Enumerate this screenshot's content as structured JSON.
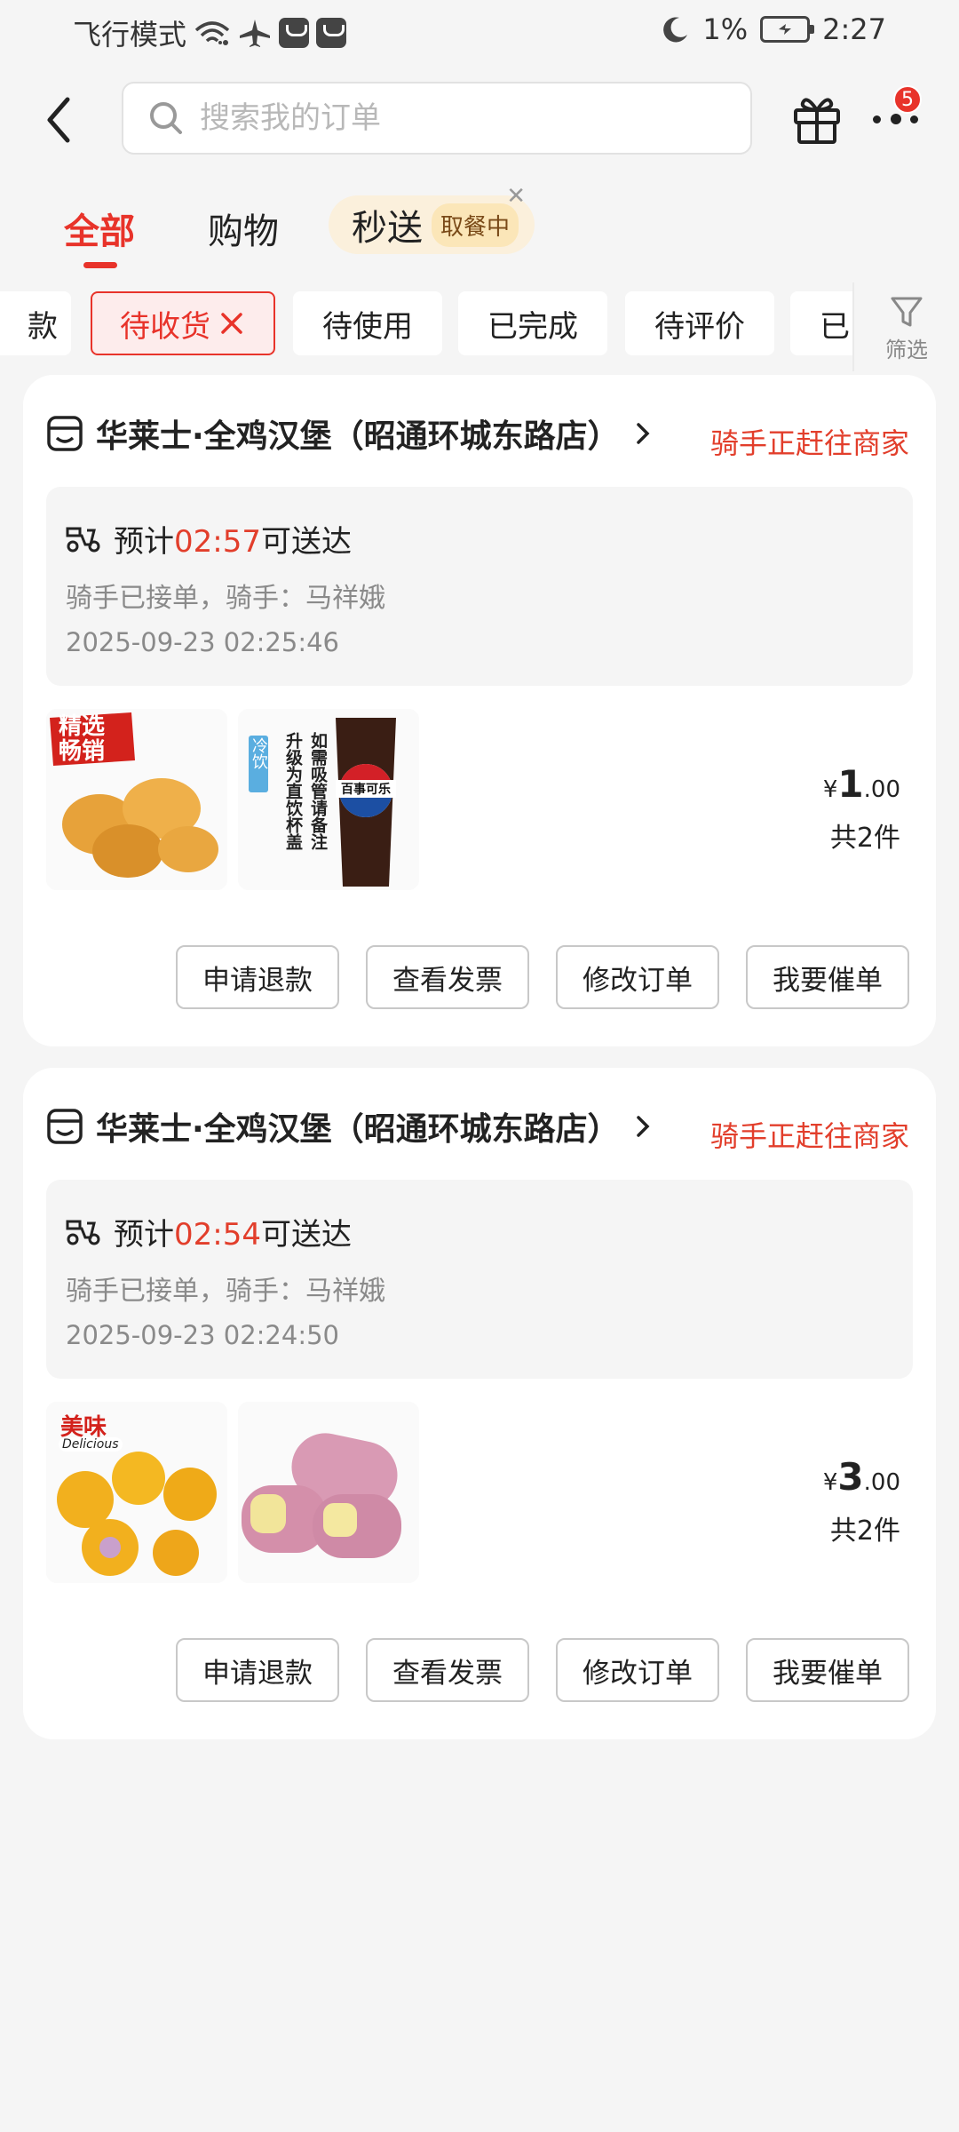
{
  "status_bar": {
    "mode": "飞行模式",
    "battery": "1%",
    "time": "2:27"
  },
  "header": {
    "search_placeholder": "搜索我的订单",
    "notification_count": "5"
  },
  "tabs": {
    "all": "全部",
    "shopping": "购物",
    "flash": "秒送",
    "flash_pill": "取餐中"
  },
  "chips": {
    "partial": "款",
    "items": [
      {
        "label": "待收货",
        "active": true
      },
      {
        "label": "待使用"
      },
      {
        "label": "已完成"
      },
      {
        "label": "待评价"
      },
      {
        "label": "已"
      }
    ]
  },
  "filter_label": "筛选",
  "orders": [
    {
      "store": "华莱士·全鸡汉堡（昭通环城东路店）",
      "status": "骑手正赶往商家",
      "eta_prefix": "预计",
      "eta_time": "02:57",
      "eta_suffix": "可送达",
      "rider": "骑手已接单，骑手：马祥娥",
      "timestamp": "2025-09-23 02:25:46",
      "price_symbol": "¥",
      "price_int": "1",
      "price_dec": ".00",
      "count": "共2件",
      "item1_badge": "精选\n畅销",
      "item2_tag": "冷饮",
      "item2_text": "如需吸管请备注 升级为直饮杯盖",
      "item2_logo": "百事可乐",
      "buttons": [
        "申请退款",
        "查看发票",
        "修改订单",
        "我要催单"
      ]
    },
    {
      "store": "华莱士·全鸡汉堡（昭通环城东路店）",
      "status": "骑手正赶往商家",
      "eta_prefix": "预计",
      "eta_time": "02:54",
      "eta_suffix": "可送达",
      "rider": "骑手已接单，骑手：马祥娥",
      "timestamp": "2025-09-23 02:24:50",
      "price_symbol": "¥",
      "price_int": "3",
      "price_dec": ".00",
      "count": "共2件",
      "item1_badge": "美味",
      "item1_sub": "Delicious",
      "buttons": [
        "申请退款",
        "查看发票",
        "修改订单",
        "我要催单"
      ]
    }
  ]
}
